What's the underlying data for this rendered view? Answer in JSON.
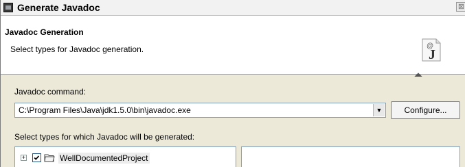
{
  "window": {
    "title": "Generate Javadoc",
    "close_glyph": "⊠"
  },
  "header": {
    "title": "Javadoc Generation",
    "description": "Select types for Javadoc generation.",
    "icon_glyph": "J",
    "icon_at": "@"
  },
  "command": {
    "label": "Javadoc command:",
    "value": "C:\\Program Files\\Java\\jdk1.5.0\\bin\\javadoc.exe",
    "dropdown_glyph": "▼",
    "configure_label": "Configure..."
  },
  "types": {
    "label": "Select types for which Javadoc will be generated:",
    "tree": [
      {
        "label": "WellDocumentedProject",
        "checked": true,
        "expander": "+"
      }
    ]
  },
  "icons": {
    "app": "eclipse-window-icon",
    "banner": "javadoc-wizard-icon",
    "project": "project-folder-icon"
  }
}
